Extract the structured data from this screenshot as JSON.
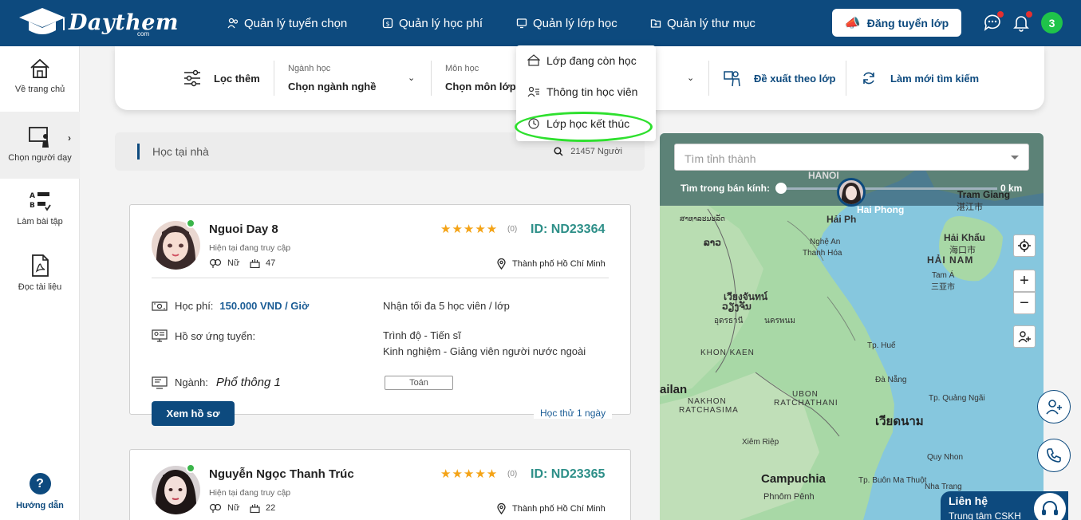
{
  "brand": {
    "name": "Daythem",
    "suffix": "com"
  },
  "nav": {
    "recruit": "Quản lý tuyển chọn",
    "fees": "Quản lý học phí",
    "classes": "Quản lý lớp học",
    "folders": "Quản lý thư mục"
  },
  "post_button": "Đăng tuyển lớp",
  "user_initial": "3",
  "sidebar": {
    "home": "Về trang chủ",
    "choose_tutor": "Chọn người dạy",
    "homework": "Làm bài tập",
    "docs": "Đọc tài liệu",
    "help": "Hướng dẫn"
  },
  "filter": {
    "more": "Lọc thêm",
    "major_label": "Ngành học",
    "major_value": "Chọn ngành nghề",
    "subject_label": "Môn học",
    "subject_value": "Chọn môn lớp",
    "suggest": "Đề xuất theo lớp",
    "refresh": "Làm mới tìm kiếm"
  },
  "dropdown": {
    "ongoing": "Lớp đang còn học",
    "students": "Thông tin học viên",
    "ended": "Lớp học kết thúc"
  },
  "searchbar": {
    "mode": "Học tại nhà",
    "count": "21457 Người"
  },
  "tutors": [
    {
      "name": "Nguoi Day 8",
      "status": "Hiện tại đang truy cập",
      "gender": "Nữ",
      "age": "47",
      "stars": "★★★★★",
      "rating_count": "(0)",
      "id": "ID: ND23364",
      "location": "Thành phố Hồ Chí Minh",
      "fee_label": "Học phí:",
      "fee_value": "150.000 VND / Giờ",
      "capacity": "Nhận tối đa 5 học viên / lớp",
      "profile_label": "Hồ sơ ứng tuyển:",
      "level": "Trình độ - Tiến sĩ",
      "experience": "Kinh nghiệm - Giảng viên người nước ngoài",
      "major_label": "Ngành:",
      "major_value": "Phổ thông 1",
      "subject": "Toán",
      "view_button": "Xem hồ sơ",
      "trial": "Học thử 1 ngày"
    },
    {
      "name": "Nguyễn Ngọc Thanh Trúc",
      "status": "Hiện tại đang truy cập",
      "gender": "Nữ",
      "age": "22",
      "stars": "★★★★★",
      "rating_count": "(0)",
      "id": "ID: ND23365",
      "location": "Thành phố Hồ Chí Minh"
    }
  ],
  "map": {
    "search_placeholder": "Tìm tỉnh thành",
    "radius_label": "Tìm trong bán kính:",
    "radius_value": "0 km",
    "places": {
      "hanoi": "HANOI",
      "haiphong": "Hải Ph",
      "haiphong2": "Hai Phong",
      "tramgiang": "Tram Giang",
      "tramgiang_cn": "湛江市",
      "laos_th": "ສາທາລະນະລັດ",
      "lao": "ລາວ",
      "nghean": "Nghệ An",
      "thanhhoa": "Thanh Hóa",
      "haikhau": "Hải Khẩu",
      "haikhau_cn": "海口市",
      "hainam": "HẢI NAM",
      "tama": "Tam Á",
      "tama_cn": "三亚市",
      "vientiane_th": "เวียงจันทน์",
      "vientiane_lo": "ວຽງຈັນ",
      "udon": "อุดรธานี",
      "nakhonphanom": "นครพนม",
      "khonkaen": "KHON KAEN",
      "hue": "Tp. Huế",
      "danang": "Đà Nẵng",
      "quangngai": "Tp. Quảng Ngãi",
      "thailand": "ailan",
      "nakhon_rat": "NAKHON",
      "ratchasima": "RATCHASIMA",
      "ubon": "UBON",
      "ratchathani": "RATCHATHANI",
      "vietnam": "เวียดนาม",
      "quynhon": "Quy Nhon",
      "siemreap": "Xiêm Riệp",
      "campuchia": "Campuchia",
      "phnompenh": "Phnôm Pênh",
      "buonmathuot": "Tp. Buôn Ma Thuột",
      "nhatrang": "Nha Trang"
    }
  },
  "contact": {
    "title": "Liên hệ",
    "subtitle": "Trung tâm CSKH"
  },
  "colors": {
    "primary": "#0d4a7e",
    "teal_id": "#2d8f88",
    "star": "#f4a316",
    "online": "#3ab54a",
    "highlight": "#2ee02e"
  }
}
